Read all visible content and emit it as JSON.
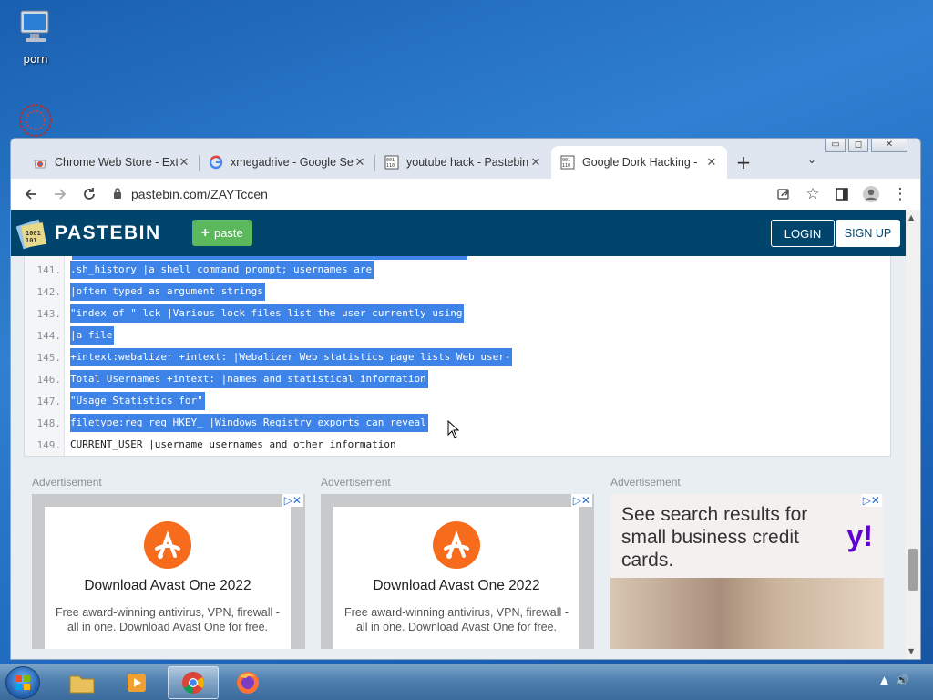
{
  "desktop": {
    "icons": [
      {
        "label": "porn"
      }
    ]
  },
  "browser": {
    "tabs": [
      {
        "title": "Chrome Web Store - Ext",
        "favicon": "chrome-webstore-icon"
      },
      {
        "title": "xmegadrive - Google Se",
        "favicon": "google-icon"
      },
      {
        "title": "youtube hack - Pastebin",
        "favicon": "pastebin-icon"
      },
      {
        "title": "Google Dork Hacking - ",
        "favicon": "pastebin-icon",
        "active": true
      }
    ],
    "new_tab": "+",
    "url": "pastebin.com/ZAYTccen"
  },
  "pastebin": {
    "brand": "PASTEBIN",
    "paste_button": "paste",
    "login": "LOGIN",
    "signup": "SIGN UP",
    "lines": [
      {
        "num": "141.",
        "text": ".sh_history |a shell command prompt; usernames are",
        "selected": true
      },
      {
        "num": "142.",
        "text": "|often typed as argument strings",
        "selected": true
      },
      {
        "num": "143.",
        "text": "\"index of \" lck |Various lock files list the user currently using",
        "selected": true
      },
      {
        "num": "144.",
        "text": "|a file",
        "selected": true
      },
      {
        "num": "145.",
        "text": "+intext:webalizer +intext: |Webalizer Web statistics page lists Web user-",
        "selected": true
      },
      {
        "num": "146.",
        "text": "Total Usernames +intext: |names and statistical information",
        "selected": true
      },
      {
        "num": "147.",
        "text": "\"Usage Statistics for\"",
        "selected": true
      },
      {
        "num": "148.",
        "text": "filetype:reg reg HKEY_ |Windows Registry exports can reveal",
        "selected": true
      },
      {
        "num": "149.",
        "text": "CURRENT_USER |username usernames and other information",
        "selected": false
      }
    ]
  },
  "ads": [
    {
      "label": "Advertisement",
      "title": "Download Avast One 2022",
      "body": "Free award-winning antivirus, VPN, firewall - all in one. Download Avast One for free."
    },
    {
      "label": "Advertisement",
      "title": "Download Avast One 2022",
      "body": "Free award-winning antivirus, VPN, firewall - all in one. Download Avast One for free."
    },
    {
      "label": "Advertisement",
      "headline": "See search results for small business credit cards.",
      "brand": "y!"
    }
  ],
  "colors": {
    "pastebin_header": "#02456c",
    "selection": "#3d83e8",
    "paste_button": "#5cb85c"
  }
}
